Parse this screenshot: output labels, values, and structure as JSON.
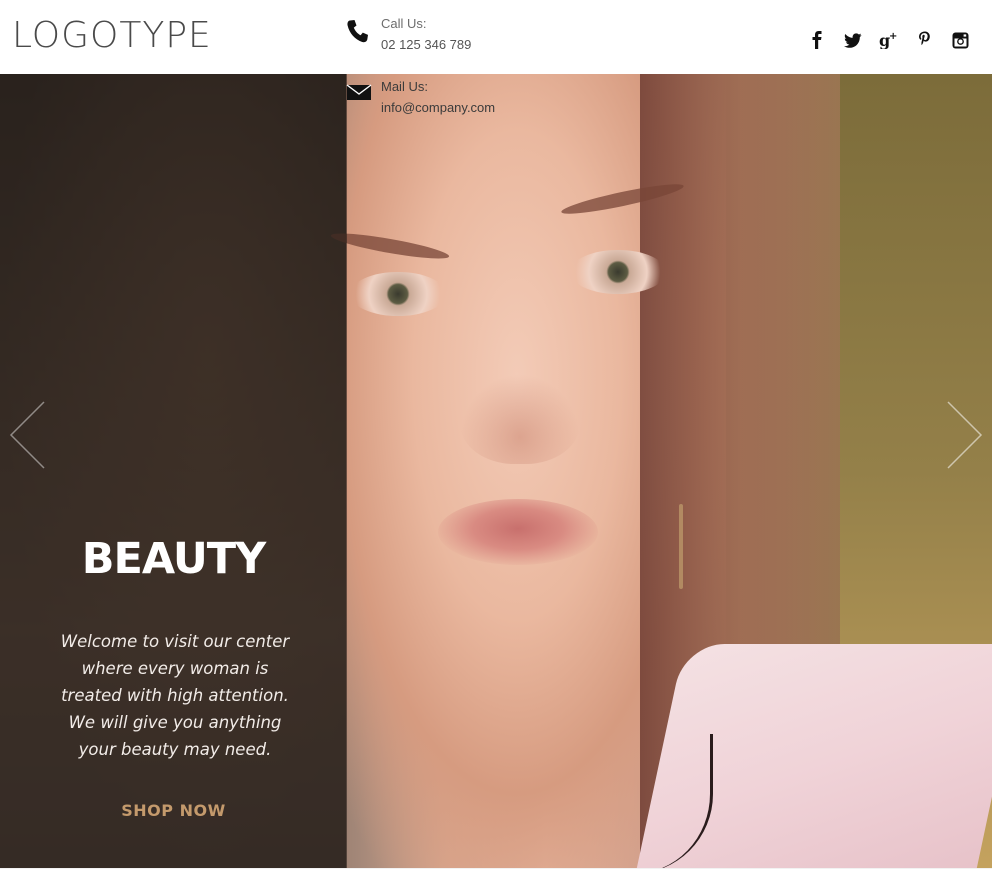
{
  "header": {
    "logo": "LOGOTYPE",
    "call": {
      "label": "Call Us:",
      "value": "02 125 346 789",
      "icon": "phone-icon"
    },
    "mail": {
      "label": "Mail Us:",
      "value": "info@company.com",
      "icon": "envelope-icon"
    },
    "social": [
      {
        "name": "facebook-icon",
        "glyph": "f"
      },
      {
        "name": "twitter-icon",
        "glyph": "t"
      },
      {
        "name": "google-plus-icon",
        "glyph": "g+"
      },
      {
        "name": "pinterest-icon",
        "glyph": "p"
      },
      {
        "name": "instagram-icon",
        "glyph": "ig"
      }
    ]
  },
  "hero": {
    "title": "BEAUTY",
    "description": "Welcome to visit our center where every woman is treated with high attention. We will give you anything your beauty may need.",
    "cta": "SHOP NOW",
    "prev_icon": "chevron-left-icon",
    "next_icon": "chevron-right-icon"
  },
  "colors": {
    "accent": "#c49a6c",
    "overlay": "rgba(38,30,26,0.62)",
    "logo": "#4a4a4a"
  }
}
